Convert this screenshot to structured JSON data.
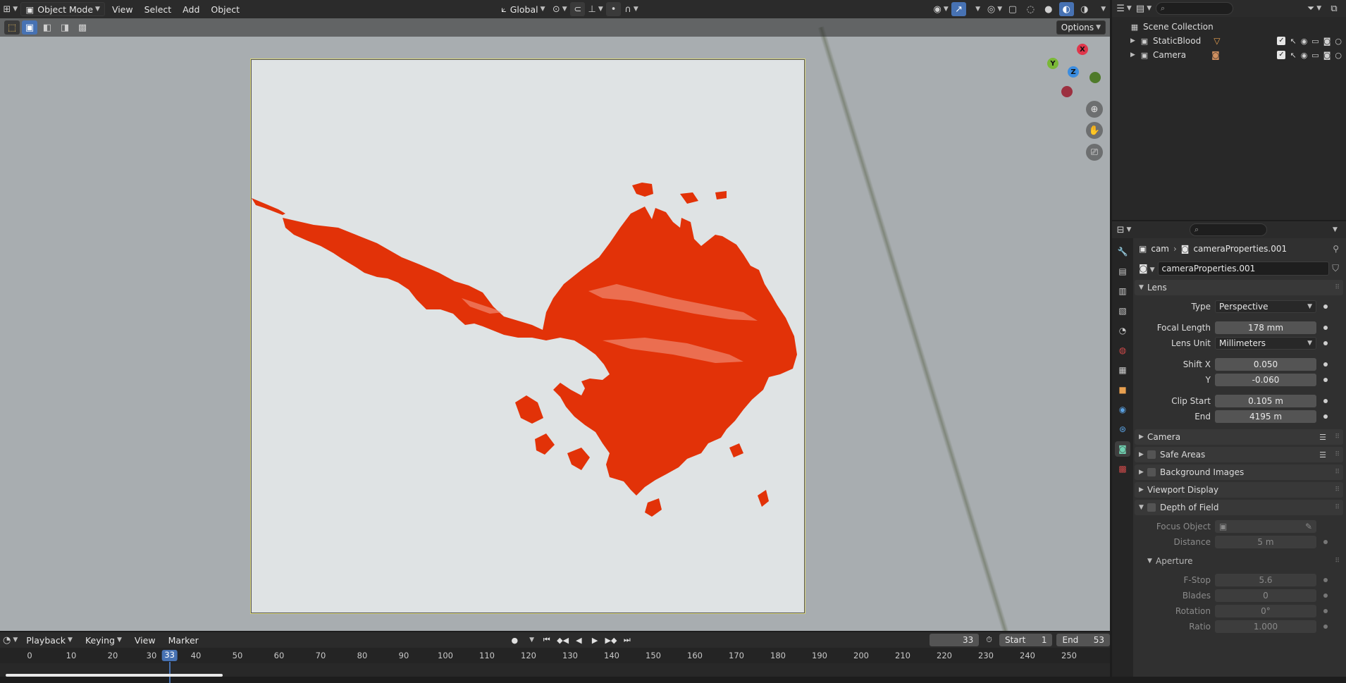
{
  "viewport": {
    "mode_label": "Object Mode",
    "menu": [
      "View",
      "Select",
      "Add",
      "Object"
    ],
    "transform_orientation": "Global",
    "options_label": "Options",
    "gizmo": {
      "x": "X",
      "y": "Y",
      "z": "Z"
    }
  },
  "outliner": {
    "root": "Scene Collection",
    "items": [
      {
        "label": "StaticBlood"
      },
      {
        "label": "Camera"
      }
    ]
  },
  "properties": {
    "breadcrumb": {
      "object": "cam",
      "data": "cameraProperties.001"
    },
    "datablock_name": "cameraProperties.001",
    "lens": {
      "header": "Lens",
      "type_label": "Type",
      "type_value": "Perspective",
      "focal_label": "Focal Length",
      "focal_value": "178 mm",
      "unit_label": "Lens Unit",
      "unit_value": "Millimeters",
      "shiftx_label": "Shift X",
      "shiftx_value": "0.050",
      "shifty_label": "Y",
      "shifty_value": "-0.060",
      "clipstart_label": "Clip Start",
      "clipstart_value": "0.105 m",
      "clipend_label": "End",
      "clipend_value": "4195 m"
    },
    "panels": {
      "camera": "Camera",
      "safe_areas": "Safe Areas",
      "background_images": "Background Images",
      "viewport_display": "Viewport Display",
      "dof": "Depth of Field"
    },
    "dof": {
      "focus_object_label": "Focus Object",
      "distance_label": "Distance",
      "distance_value": "5 m",
      "aperture_header": "Aperture",
      "fstop_label": "F-Stop",
      "fstop_value": "5.6",
      "blades_label": "Blades",
      "blades_value": "0",
      "rotation_label": "Rotation",
      "rotation_value": "0°",
      "ratio_label": "Ratio",
      "ratio_value": "1.000"
    }
  },
  "timeline": {
    "menu": [
      "Playback",
      "Keying",
      "View",
      "Marker"
    ],
    "current_frame": "33",
    "start_label": "Start",
    "start_value": "1",
    "end_label": "End",
    "end_value": "53",
    "ticks": [
      "0",
      "10",
      "20",
      "30",
      "40",
      "50",
      "60",
      "70",
      "80",
      "90",
      "100",
      "110",
      "120",
      "130",
      "140",
      "150",
      "160",
      "170",
      "180",
      "190",
      "200",
      "210",
      "220",
      "230",
      "240",
      "250"
    ]
  },
  "colors": {
    "accent": "#4772b3",
    "blood": "#e23208"
  }
}
